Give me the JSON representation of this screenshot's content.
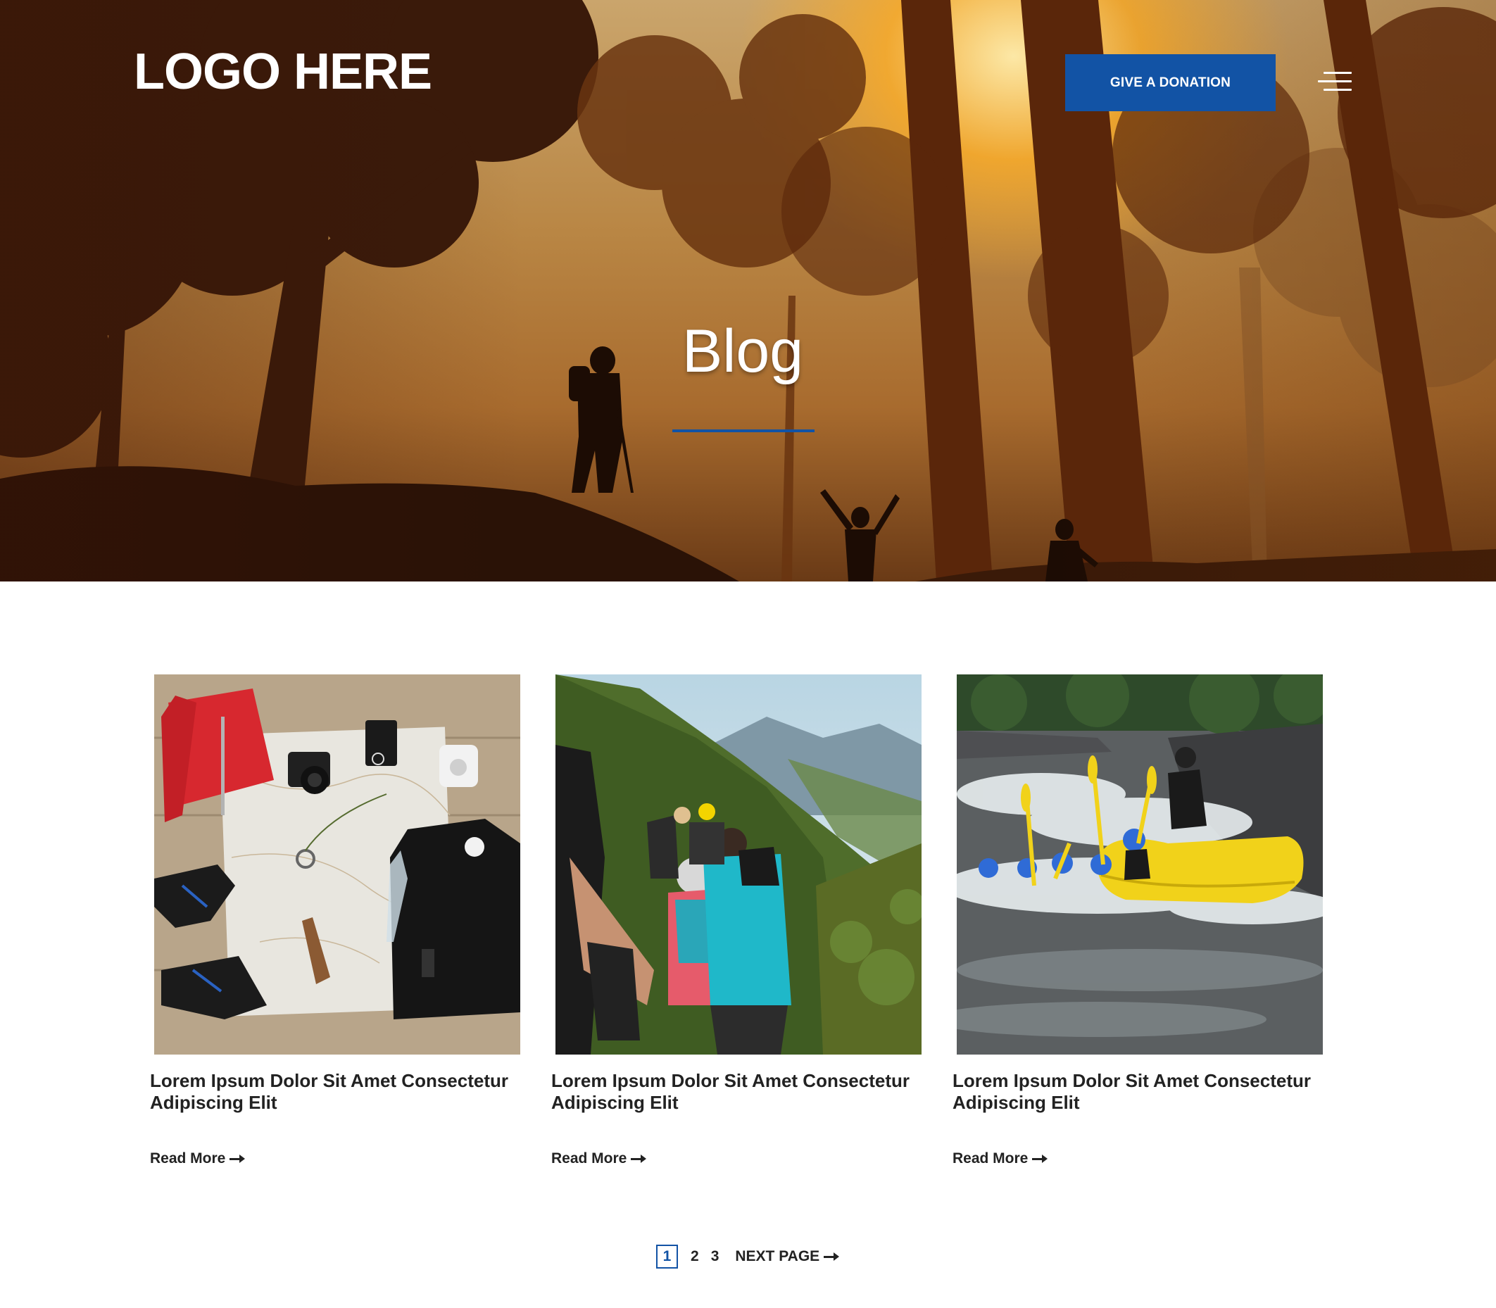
{
  "header": {
    "logo_text": "LOGO HERE",
    "donate_label": "GIVE A DONATION",
    "menu_icon": "hamburger-menu-icon"
  },
  "hero": {
    "title": "Blog"
  },
  "posts": [
    {
      "title": "Lorem Ipsum Dolor Sit Amet Consectetur Adipiscing Elit",
      "read_more": "Read More",
      "image": "travel-gear-flatlay"
    },
    {
      "title": "Lorem Ipsum Dolor Sit Amet Consectetur Adipiscing Elit",
      "read_more": "Read More",
      "image": "hikers-mountain-trail"
    },
    {
      "title": "Lorem Ipsum Dolor Sit Amet Consectetur Adipiscing Elit",
      "read_more": "Read More",
      "image": "whitewater-rafting"
    }
  ],
  "pagination": {
    "pages": [
      "1",
      "2",
      "3"
    ],
    "current": "1",
    "next_label": "NEXT PAGE"
  },
  "colors": {
    "accent": "#1253a5",
    "text": "#222222"
  }
}
